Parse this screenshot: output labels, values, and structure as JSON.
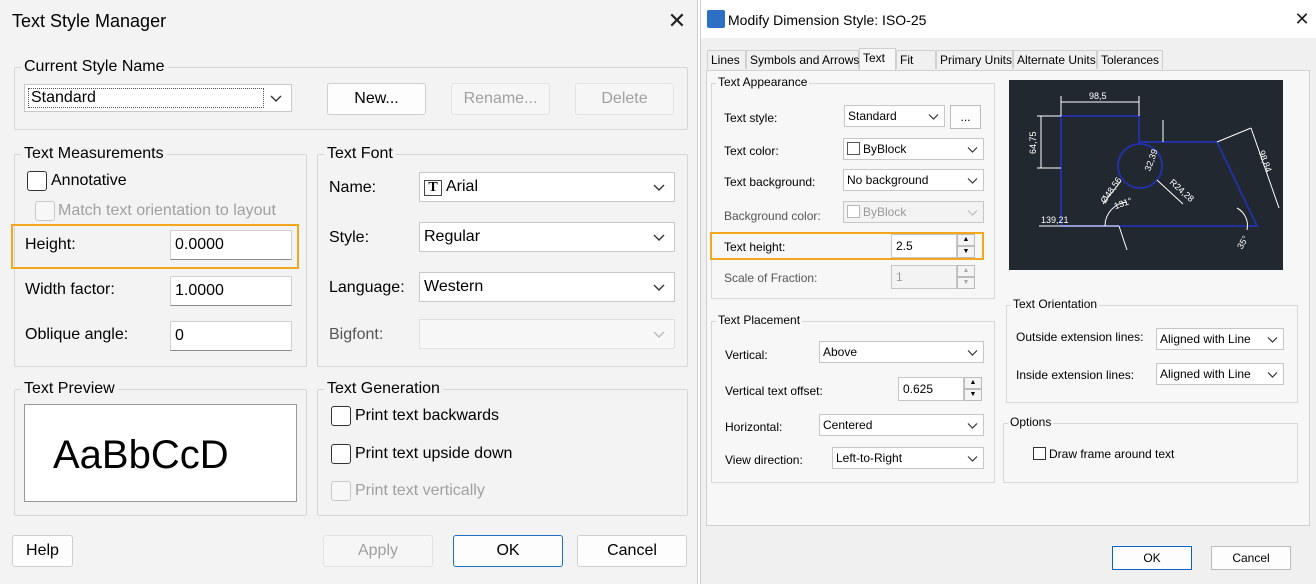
{
  "left_dialog": {
    "title": "Text Style Manager",
    "current_style": {
      "group_label": "Current Style Name",
      "selected": "Standard",
      "new_button": "New...",
      "rename_button": "Rename...",
      "delete_button": "Delete"
    },
    "measurements": {
      "group_label": "Text Measurements",
      "annotative_label": "Annotative",
      "annotative_checked": false,
      "match_orientation_label": "Match text orientation to layout",
      "height_label": "Height:",
      "height_value": "0.0000",
      "width_factor_label": "Width factor:",
      "width_factor_value": "1.0000",
      "oblique_angle_label": "Oblique angle:",
      "oblique_angle_value": "0"
    },
    "font": {
      "group_label": "Text Font",
      "name_label": "Name:",
      "name_value": "Arial",
      "style_label": "Style:",
      "style_value": "Regular",
      "language_label": "Language:",
      "language_value": "Western",
      "bigfont_label": "Bigfont:",
      "bigfont_value": ""
    },
    "preview": {
      "group_label": "Text Preview",
      "sample": "AaBbCcD"
    },
    "generation": {
      "group_label": "Text Generation",
      "backwards_label": "Print text backwards",
      "upside_down_label": "Print text upside down",
      "vertically_label": "Print text vertically"
    },
    "buttons": {
      "help": "Help",
      "apply": "Apply",
      "ok": "OK",
      "cancel": "Cancel"
    },
    "highlight_color": "#f2a81d"
  },
  "right_dialog": {
    "title": "Modify Dimension Style: ISO-25",
    "tabs": [
      "Lines",
      "Symbols and Arrows",
      "Text",
      "Fit",
      "Primary Units",
      "Alternate Units",
      "Tolerances"
    ],
    "active_tab": "Text",
    "appearance": {
      "group_label": "Text Appearance",
      "text_style_label": "Text style:",
      "text_style_value": "Standard",
      "browse_button": "...",
      "text_color_label": "Text color:",
      "text_color_value": "ByBlock",
      "text_background_label": "Text background:",
      "text_background_value": "No background",
      "background_color_label": "Background color:",
      "background_color_value": "ByBlock",
      "text_height_label": "Text height:",
      "text_height_value": "2.5",
      "scale_fraction_label": "Scale of Fraction:",
      "scale_fraction_value": "1"
    },
    "placement": {
      "group_label": "Text Placement",
      "vertical_label": "Vertical:",
      "vertical_value": "Above",
      "vertical_offset_label": "Vertical text offset:",
      "vertical_offset_value": "0.625",
      "horizontal_label": "Horizontal:",
      "horizontal_value": "Centered",
      "view_direction_label": "View direction:",
      "view_direction_value": "Left-to-Right"
    },
    "orientation": {
      "group_label": "Text Orientation",
      "outside_label": "Outside extension lines:",
      "outside_value": "Aligned with Line",
      "inside_label": "Inside extension lines:",
      "inside_value": "Aligned with Line"
    },
    "options": {
      "group_label": "Options",
      "draw_frame_label": "Draw frame around text"
    },
    "preview_labels": {
      "top": "98,5",
      "left": "64,75",
      "dia": "Ø48,56",
      "r": "R24,28",
      "mid": "32,39",
      "right": "98,84",
      "bottom": "139,21",
      "angle": "131°",
      "small_angle": "35°"
    },
    "buttons": {
      "ok": "OK",
      "cancel": "Cancel"
    }
  }
}
